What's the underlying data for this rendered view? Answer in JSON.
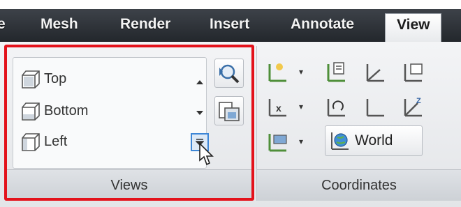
{
  "tabs": {
    "partial": "e",
    "mesh": "Mesh",
    "render": "Render",
    "insert": "Insert",
    "annotate": "Annotate",
    "view": "View"
  },
  "views_panel": {
    "title": "Views",
    "items": [
      {
        "label": "Top",
        "icon": "cube-top-icon"
      },
      {
        "label": "Bottom",
        "icon": "cube-bottom-icon"
      },
      {
        "label": "Left",
        "icon": "cube-left-icon"
      }
    ]
  },
  "coordinates_panel": {
    "title": "Coordinates",
    "world_label": "World"
  },
  "colors": {
    "highlight": "#e3121b",
    "tabbar": "#2c3036",
    "accent": "#3d86d6"
  }
}
